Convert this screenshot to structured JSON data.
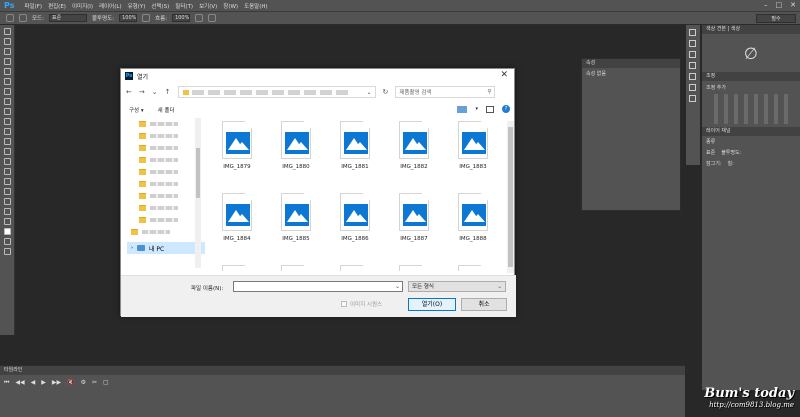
{
  "app": {
    "logo": "Ps",
    "menu": [
      "파일(F)",
      "편집(E)",
      "이미지(I)",
      "레이어(L)",
      "유형(Y)",
      "선택(S)",
      "필터(T)",
      "보기(V)",
      "창(W)",
      "도움말(H)"
    ],
    "window_buttons": [
      "–",
      "□",
      "✕"
    ]
  },
  "options_bar": {
    "mode_label": "모드:",
    "mode_value": "표준",
    "opacity_label": "불투명도:",
    "opacity_value": "100%",
    "flow_label": "흐름:",
    "flow_value": "100%"
  },
  "workspace": {
    "value": "필수"
  },
  "panels": {
    "top_tab": "색상 견본 | 색상",
    "adjust_tab": "조정",
    "adjust_title": "조정 추가",
    "layers_tab": "레이어  채널",
    "layers_kind": "종류",
    "layers_mode": "표준",
    "layers_opacity": "불투명도:",
    "layers_lock": "잠그기:",
    "layers_fill": "칠:"
  },
  "history_panel": {
    "tab": "속성",
    "title": "속성 없음"
  },
  "timeline": {
    "tab": "타임라인",
    "controls": [
      "⏮",
      "◀◀",
      "◀",
      "▶",
      "▶▶",
      "🔇",
      "⚙",
      "✂",
      "▢"
    ]
  },
  "watermark": {
    "title": "Bum's today",
    "url": "http://com9813.blog.me"
  },
  "dialog": {
    "title": "열기",
    "close": "✕",
    "nav": {
      "back": "←",
      "forward": "→",
      "down": "⌄",
      "up": "↑",
      "refresh": "↻"
    },
    "search_placeholder": "제품촬영 검색",
    "organize": "구성 ▾",
    "new_folder": "새 폴더",
    "this_pc": "내 PC",
    "files": [
      "IMG_1879",
      "IMG_1880",
      "IMG_1881",
      "IMG_1882",
      "IMG_1883",
      "IMG_1884",
      "IMG_1885",
      "IMG_1886",
      "IMG_1887",
      "IMG_1888",
      "",
      "",
      "",
      "",
      ""
    ],
    "filename_label": "파일 이름(N):",
    "filename_value": "",
    "filetype_value": "모든 형식",
    "preview_label": "이미지 시퀀스",
    "open_button": "열기(O)",
    "cancel_button": "취소"
  }
}
